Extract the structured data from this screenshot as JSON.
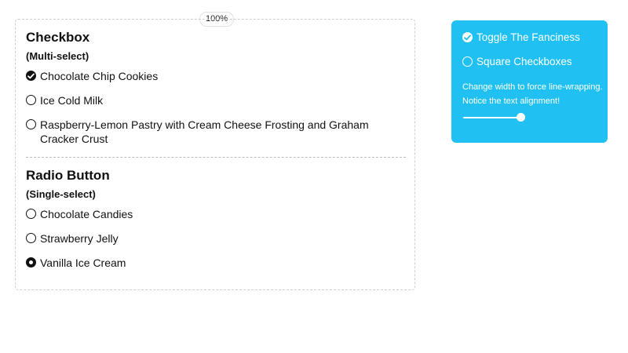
{
  "zoom": "100%",
  "checkbox_group": {
    "title": "Checkbox",
    "subtitle": "(Multi-select)",
    "options": [
      {
        "label": "Chocolate Chip Cookies",
        "checked": true
      },
      {
        "label": "Ice Cold Milk",
        "checked": false
      },
      {
        "label": "Raspberry-Lemon Pastry with Cream Cheese Frosting and Graham Cracker Crust",
        "checked": false
      }
    ]
  },
  "radio_group": {
    "title": "Radio Button",
    "subtitle": "(Single-select)",
    "options": [
      {
        "label": "Chocolate Candies",
        "selected": false
      },
      {
        "label": "Strawberry Jelly",
        "selected": false
      },
      {
        "label": "Vanilla Ice Cream",
        "selected": true
      }
    ]
  },
  "settings": {
    "toggle_fanciness": {
      "label": "Toggle The Fanciness",
      "checked": true
    },
    "square_checkboxes": {
      "label": "Square Checkboxes",
      "checked": false
    },
    "note": "Change width to force line-wrapping. Notice the text alignment!",
    "width_slider_value": 0.85
  },
  "colors": {
    "panel": "#20c0f3",
    "ink": "#111111"
  }
}
